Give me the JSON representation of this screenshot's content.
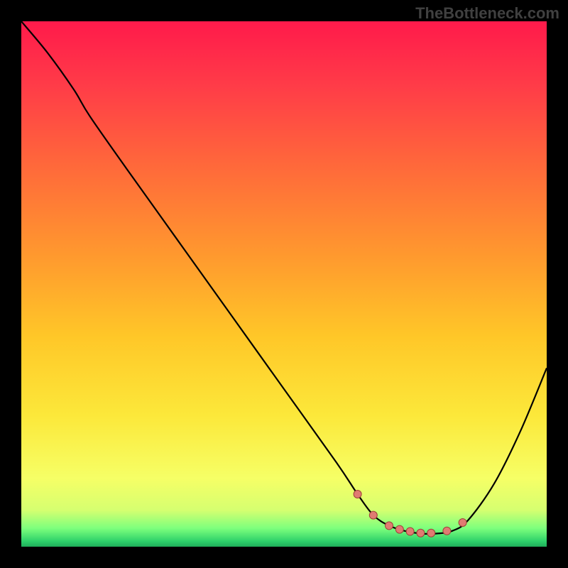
{
  "watermark": "TheBottleneck.com",
  "colors": {
    "page_bg": "#000000",
    "curve": "#000000",
    "marker_fill": "#e07b72",
    "marker_stroke": "#a04038"
  },
  "gradient_stops": [
    {
      "offset": 0.0,
      "color": "#ff1a4b"
    },
    {
      "offset": 0.12,
      "color": "#ff3b48"
    },
    {
      "offset": 0.28,
      "color": "#ff6a3a"
    },
    {
      "offset": 0.45,
      "color": "#ff9a2e"
    },
    {
      "offset": 0.6,
      "color": "#ffc728"
    },
    {
      "offset": 0.75,
      "color": "#fce83a"
    },
    {
      "offset": 0.87,
      "color": "#f6ff66"
    },
    {
      "offset": 0.93,
      "color": "#d6ff70"
    },
    {
      "offset": 0.965,
      "color": "#7dff7d"
    },
    {
      "offset": 0.99,
      "color": "#2dd06a"
    },
    {
      "offset": 1.0,
      "color": "#1fae5a"
    }
  ],
  "chart_data": {
    "type": "line",
    "title": "",
    "xlabel": "",
    "ylabel": "",
    "xlim": [
      0,
      100
    ],
    "ylim": [
      0,
      100
    ],
    "series": [
      {
        "name": "bottleneck-curve",
        "x": [
          0,
          5,
          10,
          13,
          20,
          30,
          40,
          50,
          60,
          64,
          67,
          70,
          73,
          76,
          79,
          82,
          85,
          90,
          95,
          100
        ],
        "y": [
          100,
          94,
          87,
          82,
          72,
          58,
          44,
          30,
          16,
          10,
          6,
          4,
          3,
          2.5,
          2.5,
          3,
          5,
          12,
          22,
          34
        ]
      }
    ],
    "markers": {
      "name": "optimal-range-points",
      "x": [
        64,
        67,
        70,
        72,
        74,
        76,
        78,
        81,
        84
      ],
      "y": [
        10,
        6,
        4,
        3.3,
        2.9,
        2.6,
        2.6,
        3,
        4.6
      ]
    }
  }
}
